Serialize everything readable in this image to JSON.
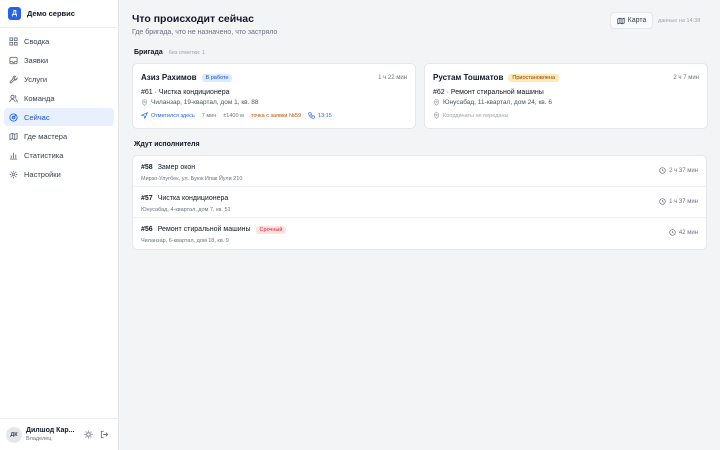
{
  "brand": {
    "logo_letter": "Д",
    "name": "Демо сервис"
  },
  "nav": [
    {
      "label": "Сводка",
      "icon": "grid-icon"
    },
    {
      "label": "Заявки",
      "icon": "inbox-icon"
    },
    {
      "label": "Услуги",
      "icon": "wrench-icon"
    },
    {
      "label": "Команда",
      "icon": "users-icon"
    },
    {
      "label": "Сейчас",
      "icon": "radar-icon",
      "active": true
    },
    {
      "label": "Где мастера",
      "icon": "map-icon"
    },
    {
      "label": "Статистика",
      "icon": "bar-chart-icon"
    },
    {
      "label": "Настройки",
      "icon": "gear-icon"
    }
  ],
  "user": {
    "initials": "ДК",
    "name": "Дилшод Кар...",
    "role": "Владелец"
  },
  "header": {
    "title": "Что происходит сейчас",
    "subtitle": "Где бригада, что не назначено, что застряло",
    "map_label": "Карта",
    "updated": "данные на 14:38"
  },
  "crew": {
    "title": "Бригада",
    "note": "без отметки: 1",
    "cards": [
      {
        "name": "Азиз Рахимов",
        "status": "В работе",
        "duration": "1 ч 22 мин",
        "job": "#61 · Чистка кондиционера",
        "address": "Чиланзар, 19-квартал, дом 1, кв. 88",
        "checkin": "Отметился здесь",
        "checkin_ago": "7 мин",
        "accuracy": "±1400 м",
        "point_note": "точка с заявки №59",
        "call_time": "13:15"
      },
      {
        "name": "Рустам Тошматов",
        "status": "Приостановлена",
        "duration": "2 ч 7 мин",
        "job": "#62 · Ремонт стиральной машины",
        "address": "Юнусабад, 11-квартал, дом 24, кв. 6",
        "coords_note": "Координаты не переданы"
      }
    ]
  },
  "queue": {
    "title": "Ждут исполнителя",
    "items": [
      {
        "number": "#58",
        "title": "Замер окон",
        "address": "Мирзо-Улугбек, ул. Буюк Ипак Йули 210",
        "wait": "2 ч 37 мин"
      },
      {
        "number": "#57",
        "title": "Чистка кондиционера",
        "address": "Юнусабад, 4-квартал, дом 7, кв. 51",
        "wait": "1 ч 37 мин"
      },
      {
        "number": "#56",
        "title": "Ремонт стиральной машины",
        "badge": "Срочный",
        "address": "Чиланзар, 6-квартал, дом 18, кв. 9",
        "wait": "42 мин"
      }
    ]
  },
  "colors": {
    "accent": "#2563eb",
    "active_bg": "#e8f0fe",
    "urgent": "#dc2626",
    "paused": "#fde9b5"
  }
}
